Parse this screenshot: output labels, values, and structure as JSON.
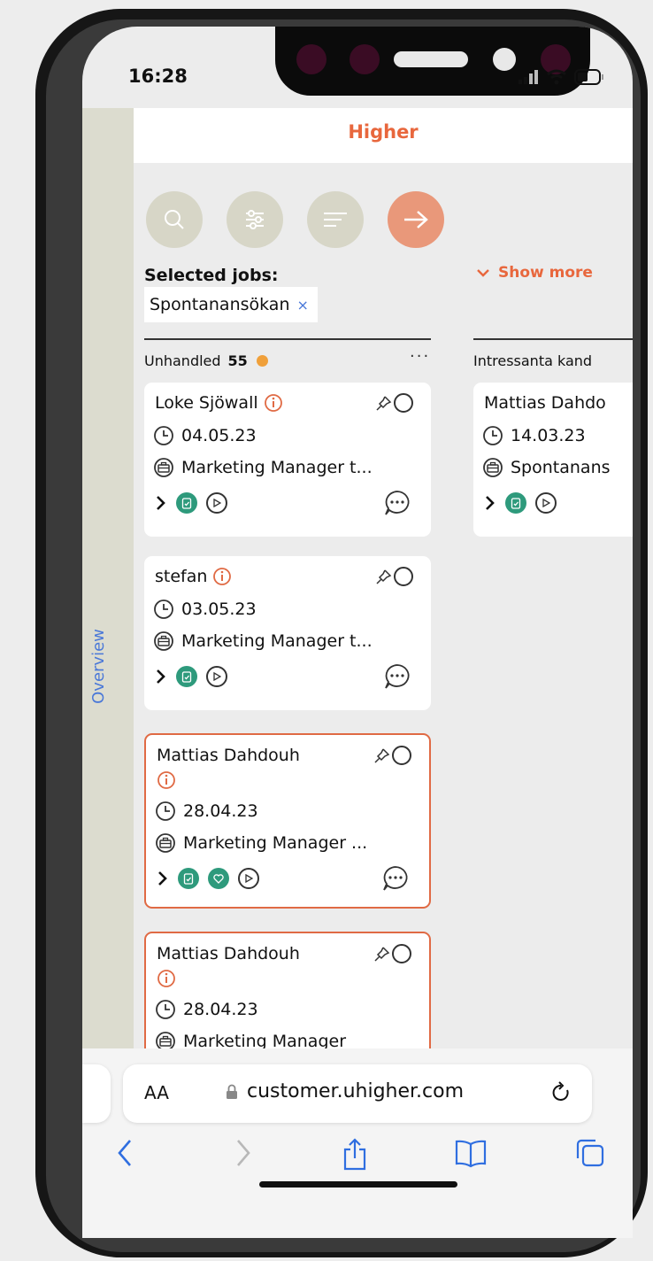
{
  "status_bar": {
    "time": "16:28"
  },
  "app": {
    "logo": "Higher",
    "sidebar_label": "Overview"
  },
  "toolbar": {
    "buttons": [
      "search-icon",
      "filter-sliders-icon",
      "sort-lines-icon",
      "arrow-right-icon"
    ]
  },
  "filters": {
    "selected_label": "Selected jobs:",
    "chip_label": "Spontanansökan",
    "chip_remove": "×",
    "show_more": "Show more"
  },
  "columns": [
    {
      "title": "Unhandled",
      "count": "55",
      "more": "···"
    },
    {
      "title": "Intressanta kand"
    }
  ],
  "cards": [
    {
      "name": "Loke Sjöwall",
      "date": "04.05.23",
      "job": "Marketing Manager t..."
    },
    {
      "name": "stefan",
      "date": "03.05.23",
      "job": "Marketing Manager t..."
    },
    {
      "name": "Mattias Dahdouh",
      "date": "28.04.23",
      "job": "Marketing Manager ..."
    },
    {
      "name": "Mattias Dahdouh",
      "date": "28.04.23",
      "job": "Marketing Manager"
    },
    {
      "name": "Mattias Dahdo",
      "date": "14.03.23",
      "job": "Spontanans"
    }
  ],
  "browser": {
    "text_size": "AA",
    "url": "customer.uhigher.com"
  },
  "colors": {
    "accent": "#e8673d",
    "green": "#2e9a7c",
    "sidebar": "#dcdccf",
    "link_blue": "#4a78d8"
  }
}
